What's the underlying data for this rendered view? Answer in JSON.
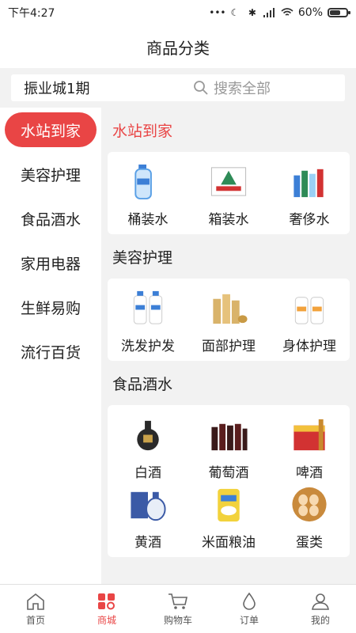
{
  "status_bar": {
    "time": "下午4:27",
    "battery": "60%"
  },
  "header": {
    "title": "商品分类"
  },
  "search": {
    "location": "振业城1期",
    "placeholder": "搜索全部"
  },
  "sidebar": {
    "items": [
      {
        "label": "水站到家"
      },
      {
        "label": "美容护理"
      },
      {
        "label": "食品酒水"
      },
      {
        "label": "家用电器"
      },
      {
        "label": "生鲜易购"
      },
      {
        "label": "流行百货"
      }
    ]
  },
  "sections": [
    {
      "title": "水站到家",
      "items": [
        {
          "label": "桶装水",
          "icon": "water-jug-icon"
        },
        {
          "label": "箱装水",
          "icon": "water-box-icon"
        },
        {
          "label": "奢侈水",
          "icon": "premium-water-icon"
        }
      ]
    },
    {
      "title": "美容护理",
      "items": [
        {
          "label": "洗发护发",
          "icon": "shampoo-icon"
        },
        {
          "label": "面部护理",
          "icon": "skincare-icon"
        },
        {
          "label": "身体护理",
          "icon": "bodycare-icon"
        }
      ]
    },
    {
      "title": "食品酒水",
      "items": [
        {
          "label": "白酒",
          "icon": "baijiu-icon"
        },
        {
          "label": "葡萄酒",
          "icon": "wine-icon"
        },
        {
          "label": "啤酒",
          "icon": "beer-icon"
        },
        {
          "label": "黄酒",
          "icon": "yellow-wine-icon"
        },
        {
          "label": "米面粮油",
          "icon": "rice-icon"
        },
        {
          "label": "蛋类",
          "icon": "eggs-icon"
        }
      ]
    }
  ],
  "bottom_nav": {
    "items": [
      {
        "label": "首页",
        "icon": "home-icon"
      },
      {
        "label": "商城",
        "icon": "mall-icon"
      },
      {
        "label": "购物车",
        "icon": "cart-icon"
      },
      {
        "label": "订单",
        "icon": "order-icon"
      },
      {
        "label": "我的",
        "icon": "profile-icon"
      }
    ]
  },
  "colors": {
    "accent": "#e94545"
  }
}
